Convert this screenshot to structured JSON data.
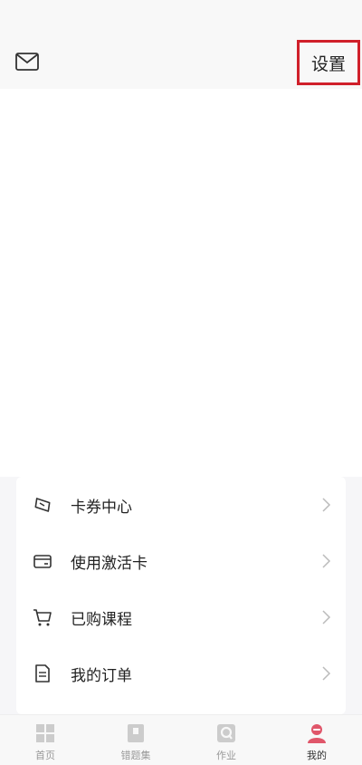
{
  "header": {
    "settings_label": "设置",
    "mail_icon": "mail-icon"
  },
  "menu": {
    "items": [
      {
        "label": "卡券中心",
        "icon": "ticket-icon"
      },
      {
        "label": "使用激活卡",
        "icon": "card-icon"
      },
      {
        "label": "已购课程",
        "icon": "cart-icon"
      },
      {
        "label": "我的订单",
        "icon": "document-icon"
      }
    ]
  },
  "tabbar": {
    "tabs": [
      {
        "label": "首页",
        "icon": "home-grid-icon"
      },
      {
        "label": "错题集",
        "icon": "notebook-icon"
      },
      {
        "label": "作业",
        "icon": "homework-icon"
      },
      {
        "label": "我的",
        "icon": "profile-icon",
        "active": true
      }
    ]
  },
  "colors": {
    "highlight": "#d0202a",
    "accent": "#e0566a",
    "tab_inactive": "#cccccc",
    "background": "#f6f6f8"
  }
}
